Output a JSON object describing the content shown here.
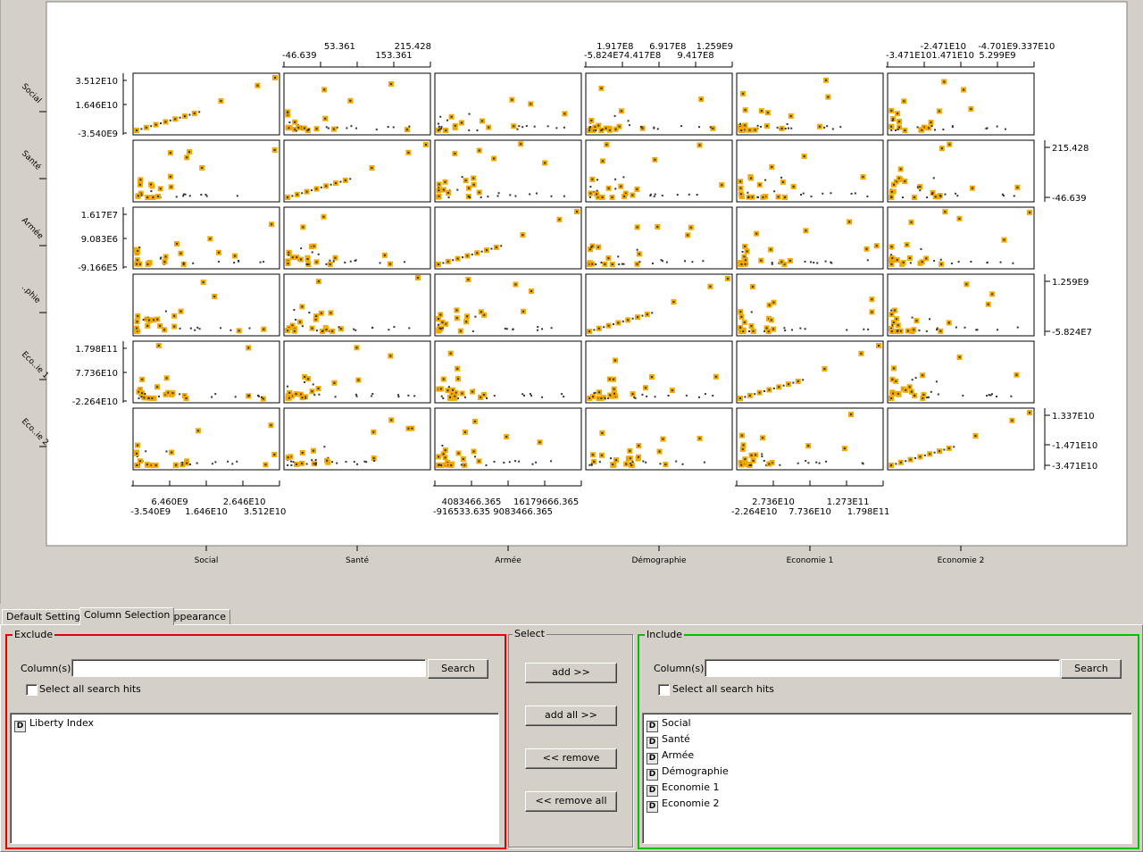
{
  "plot": {
    "columns": [
      "Social",
      "Santé",
      "Armée",
      "Démographie",
      "Economie 1",
      "Economie 2"
    ],
    "row_labels": [
      "Social",
      "Santé",
      "Armée",
      "..phie",
      "Eco..ie 1",
      "Eco..ie 2"
    ],
    "left_axes": [
      {
        "row": 0,
        "ticks": [
          "3.512E10",
          "1.646E10",
          "-3.540E9"
        ]
      },
      {
        "row": 2,
        "ticks": [
          "1.617E7",
          "9.083E6",
          "-9.166E5"
        ]
      },
      {
        "row": 4,
        "ticks": [
          "1.798E11",
          "7.736E10",
          "-2.264E10"
        ]
      }
    ],
    "right_axes": [
      {
        "row": 1,
        "ticks": [
          "215.428",
          "-46.639"
        ]
      },
      {
        "row": 3,
        "ticks": [
          "1.259E9",
          "-5.824E7"
        ]
      },
      {
        "row": 5,
        "ticks": [
          "1.337E10",
          "-1.471E10",
          "-3.471E10"
        ]
      }
    ],
    "top_axes": [
      {
        "col": 1,
        "upper": [
          "53.361",
          "215.428"
        ],
        "lower": [
          "-46.639",
          "153.361"
        ]
      },
      {
        "col": 3,
        "upper": [
          "1.917E8",
          "6.917E8",
          "1.259E9"
        ],
        "lower": [
          "-5.824E74.417E8",
          "9.417E8"
        ]
      },
      {
        "col": 5,
        "upper": [
          "-2.471E10",
          "-4.701E9.337E10"
        ],
        "lower": [
          "-3.471E101.471E10",
          "5.299E9"
        ]
      }
    ],
    "bottom_axes": [
      {
        "col": 0,
        "upper": [
          "6.460E9",
          "2.646E10"
        ],
        "lower": [
          "-3.540E9",
          "1.646E10",
          "3.512E10"
        ]
      },
      {
        "col": 2,
        "upper": [
          "4083466.365",
          "16179666.365"
        ],
        "lower": [
          "-916533.635 9083466.365"
        ]
      },
      {
        "col": 4,
        "upper": [
          "2.736E10",
          "1.273E11"
        ],
        "lower": [
          "-2.264E10",
          "7.736E10",
          "1.798E11"
        ]
      }
    ],
    "colors": {
      "highlight": "#f2a900",
      "point": "#333333",
      "frame": "#000000"
    }
  },
  "tabs": [
    {
      "label": "Default Settings",
      "active": false
    },
    {
      "label": "Column Selection",
      "active": true
    },
    {
      "label": "Appearance",
      "active": false
    }
  ],
  "exclude": {
    "title": "Exclude",
    "columns_label": "Column(s):",
    "search_value": "",
    "search_button": "Search",
    "select_all_label": "Select all search hits",
    "items": [
      "Liberty Index"
    ],
    "border_color": "#e00000"
  },
  "select": {
    "title": "Select",
    "add": "add >>",
    "add_all": "add all >>",
    "remove": "<< remove",
    "remove_all": "<< remove all"
  },
  "include": {
    "title": "Include",
    "columns_label": "Column(s):",
    "search_value": "",
    "search_button": "Search",
    "select_all_label": "Select all search hits",
    "items": [
      "Social",
      "Santé",
      "Armée",
      "Démographie",
      "Economie 1",
      "Economie 2"
    ],
    "border_color": "#00c000"
  }
}
